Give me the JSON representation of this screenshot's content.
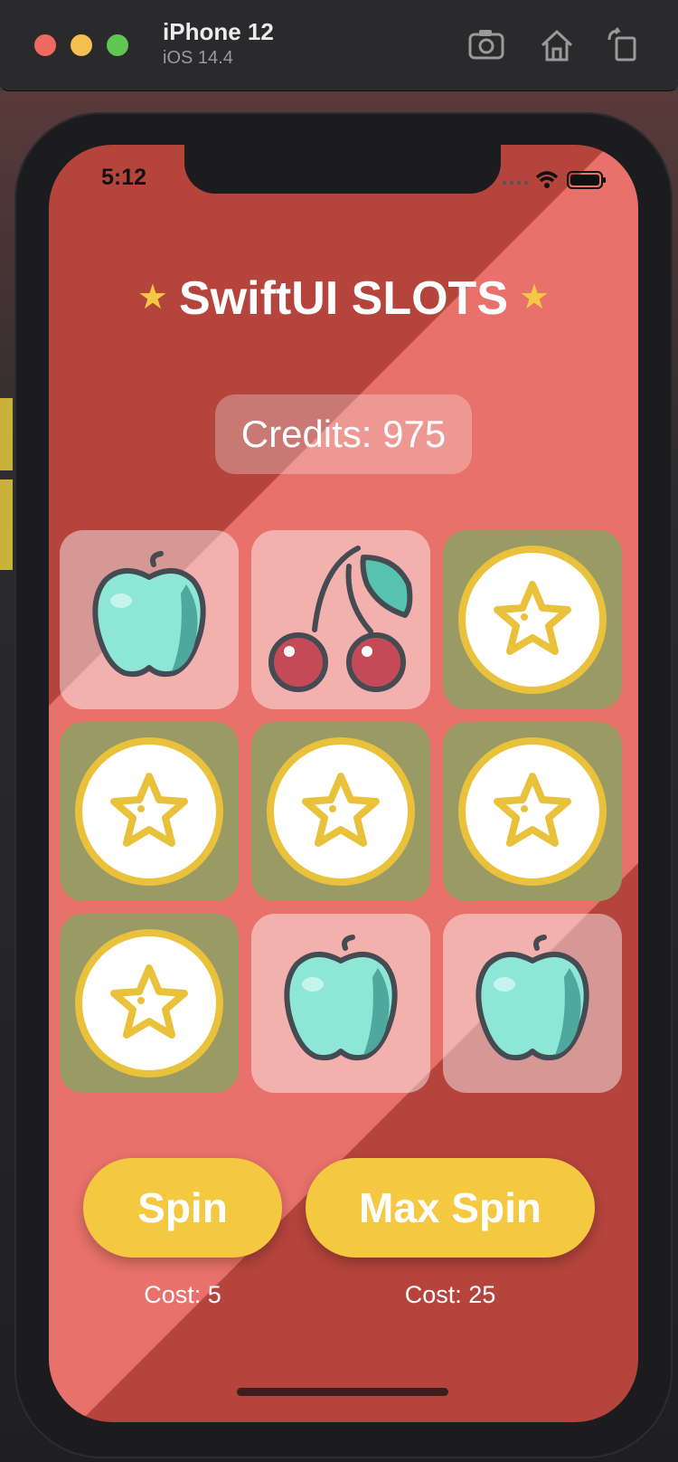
{
  "simulator": {
    "device_name": "iPhone 12",
    "os_version": "iOS 14.4",
    "toolbar_icons": [
      "screenshot-icon",
      "home-icon",
      "rotate-icon"
    ]
  },
  "status_bar": {
    "time": "5:12"
  },
  "app": {
    "title": "SwiftUI SLOTS",
    "title_star": "★",
    "credits_text": "Credits: 975",
    "slots": [
      {
        "symbol": "apple",
        "highlight": false
      },
      {
        "symbol": "cherry",
        "highlight": false
      },
      {
        "symbol": "star",
        "highlight": true
      },
      {
        "symbol": "star",
        "highlight": true
      },
      {
        "symbol": "star",
        "highlight": true
      },
      {
        "symbol": "star",
        "highlight": true
      },
      {
        "symbol": "star",
        "highlight": true
      },
      {
        "symbol": "apple",
        "highlight": false
      },
      {
        "symbol": "apple",
        "highlight": false
      }
    ],
    "spin_button": "Spin",
    "spin_cost": "Cost: 5",
    "max_spin_button": "Max Spin",
    "max_spin_cost": "Cost: 25"
  },
  "colors": {
    "background_dark": "#b5443d",
    "background_light": "#e8716b",
    "win_tile": "#9a9a64",
    "button": "#f5c842"
  }
}
